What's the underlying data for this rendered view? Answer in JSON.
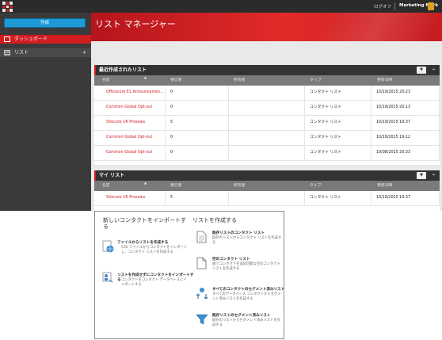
{
  "topbar": {
    "logout": "ログオフ",
    "user": "Marketing Mark"
  },
  "sidebar": {
    "create_button": "作成",
    "items": [
      {
        "label": "ダッシュボード"
      },
      {
        "label": "リスト"
      }
    ]
  },
  "header": {
    "title": "リスト マネージャー"
  },
  "columns": {
    "name": "名前",
    "recipients": "受信者",
    "owner": "所有者",
    "type": "タイプ",
    "updated": "更新日時"
  },
  "recent": {
    "title": "最近作成されたリスト",
    "rows": [
      {
        "name": "Officecore E1 Announcemen...",
        "recipients": "0",
        "owner": "",
        "type": "コンタクト リスト",
        "updated": "10/19/2015 20:23"
      },
      {
        "name": "Common Global Opt-out",
        "recipients": "0",
        "owner": "",
        "type": "コンタクト リスト",
        "updated": "10/19/2015 20:13"
      },
      {
        "name": "Sitecore UK Prosales",
        "recipients": "5",
        "owner": "",
        "type": "コンタクト リスト",
        "updated": "10/19/2015 19:37"
      },
      {
        "name": "Common Global Opt-out",
        "recipients": "0",
        "owner": "",
        "type": "コンタクト リスト",
        "updated": "10/19/2015 19:12"
      },
      {
        "name": "Common Global Opt-out",
        "recipients": "0",
        "owner": "",
        "type": "コンタクト リスト",
        "updated": "10/08/2015 20:33"
      }
    ]
  },
  "mylist": {
    "title": "マイ リスト",
    "rows": [
      {
        "name": "Sitecore UK Prosales",
        "recipients": "5",
        "owner": "",
        "type": "コンタクト リスト",
        "updated": "10/19/2015 19:37"
      }
    ]
  },
  "import_card": {
    "import_title": "新しいコンタクトをインポートする",
    "create_title": "リストを作成する",
    "import_options": [
      {
        "icon": "file-globe-icon",
        "title": "ファイルからリストを作成する",
        "desc": "CSV ファイルからコンタクトをインポートし、コンタクト リストを作成する"
      },
      {
        "icon": "contacts-import-icon",
        "title": "リストを作成せずにコンタクトをインポートする",
        "desc": "コンタクトをコンタクト データベースにインポートする"
      }
    ],
    "create_options": [
      {
        "icon": "document-icon",
        "title": "既存リストのコンタクト リスト",
        "desc": "既存のリストからコンタクト リストを作成する"
      },
      {
        "icon": "empty-document-icon",
        "title": "空のコンタクト リスト",
        "desc": "後でコンタクトを追加可能な空のコンタクト リストを作成する"
      },
      {
        "icon": "all-contacts-segment-icon",
        "title": "すべてのコンタクトのセグメント済みリスト",
        "desc": "すべてのデータベース コンタクトからセグメント済みリストを作成する"
      },
      {
        "icon": "funnel-segment-icon",
        "title": "既存リストのセグメント済みリスト",
        "desc": "既存のリストからセグメント済みリストを作成する"
      }
    ]
  },
  "colors": {
    "accent": "#d11c20",
    "primary_button": "#1d9ad6",
    "topbar": "#2b2b2b"
  }
}
